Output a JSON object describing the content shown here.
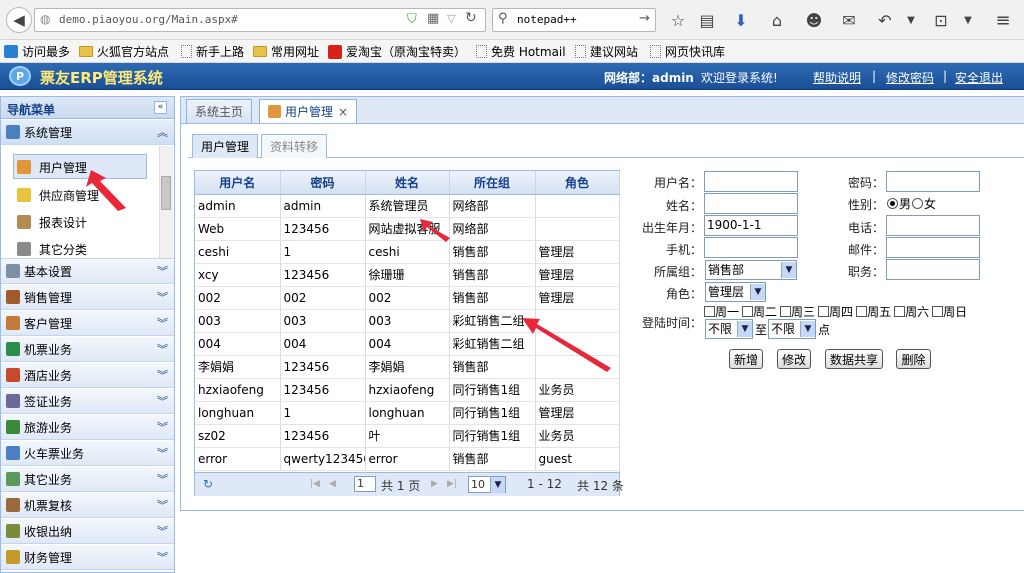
{
  "browser": {
    "url": "demo.piaoyou.org/Main.aspx#",
    "search_text": "notepad++",
    "bookmarks": [
      "访问最多",
      "火狐官方站点",
      "新手上路",
      "常用网址",
      "爱淘宝（原淘宝特卖）",
      "免费 Hotmail",
      "建议网站",
      "网页快讯库"
    ]
  },
  "header": {
    "title": "票友ERP管理系统",
    "logo_letter": "P",
    "user_info": "网络部：admin",
    "welcome": "欢迎登录系统!",
    "links": [
      "帮助说明",
      "修改密码",
      "安全退出"
    ],
    "separator": "|"
  },
  "sidebar": {
    "title": "导航菜单",
    "collapse_glyph": "«",
    "expanded_section": "系统管理",
    "sub_items": [
      "用户管理",
      "供应商管理",
      "报表设计",
      "其它分类"
    ],
    "sections": [
      "基本设置",
      "销售管理",
      "客户管理",
      "机票业务",
      "酒店业务",
      "签证业务",
      "旅游业务",
      "火车票业务",
      "其它业务",
      "机票复核",
      "收银出纳",
      "财务管理"
    ]
  },
  "tabs": {
    "home": "系统主页",
    "active": "用户管理",
    "close_glyph": "×"
  },
  "subtabs": [
    "用户管理",
    "资料转移"
  ],
  "grid": {
    "columns": [
      "用户名",
      "密码",
      "姓名",
      "所在组",
      "角色"
    ],
    "rows": [
      [
        "admin",
        "admin",
        "系统管理员",
        "网络部",
        ""
      ],
      [
        "Web",
        "123456",
        "网站虚拟客服",
        "网络部",
        ""
      ],
      [
        "ceshi",
        "1",
        "ceshi",
        "销售部",
        "管理层"
      ],
      [
        "xcy",
        "123456",
        "徐珊珊",
        "销售部",
        "管理层"
      ],
      [
        "002",
        "002",
        "002",
        "销售部",
        "管理层"
      ],
      [
        "003",
        "003",
        "003",
        "彩虹销售二组",
        ""
      ],
      [
        "004",
        "004",
        "004",
        "彩虹销售二组",
        ""
      ],
      [
        "李娟娟",
        "123456",
        "李娟娟",
        "销售部",
        ""
      ],
      [
        "hzxiaofeng",
        "123456",
        "hzxiaofeng",
        "同行销售1组",
        "业务员"
      ],
      [
        "longhuan",
        "1",
        "longhuan",
        "同行销售1组",
        "管理层"
      ],
      [
        "sz02",
        "123456",
        "叶",
        "同行销售1组",
        "业务员"
      ],
      [
        "error",
        "qwerty123456",
        "error",
        "销售部",
        "guest"
      ]
    ],
    "pager": {
      "page": "1",
      "total_pages_text": "共 1 页",
      "page_size": "10",
      "range": "1 - 12",
      "total_text": "共 12 条"
    }
  },
  "form": {
    "labels": {
      "username": "用户名：",
      "password": "密码：",
      "name": "姓名：",
      "gender": "性别：",
      "birth": "出生年月：",
      "phone": "电话：",
      "mobile": "手机：",
      "email": "邮件：",
      "group": "所属组：",
      "duty": "职务：",
      "role": "角色：",
      "login_time": "登陆时间："
    },
    "birth_value": "1900-1-1",
    "gender_options": [
      "男",
      "女"
    ],
    "gender_selected": "男",
    "group_value": "销售部",
    "role_value": "管理层",
    "weekdays": [
      "周一",
      "周二",
      "周三",
      "周四",
      "周五",
      "周六",
      "周日"
    ],
    "time_from": "不限",
    "time_to_label": "至",
    "time_to": "不限",
    "time_suffix": "点",
    "buttons": [
      "新增",
      "修改",
      "数据共享",
      "删除"
    ]
  },
  "colors": {
    "header_bg": "#1f5aa3",
    "title": "#ffe97a",
    "panel_border": "#99bbe8",
    "annotation_arrow": "#e8283a"
  }
}
